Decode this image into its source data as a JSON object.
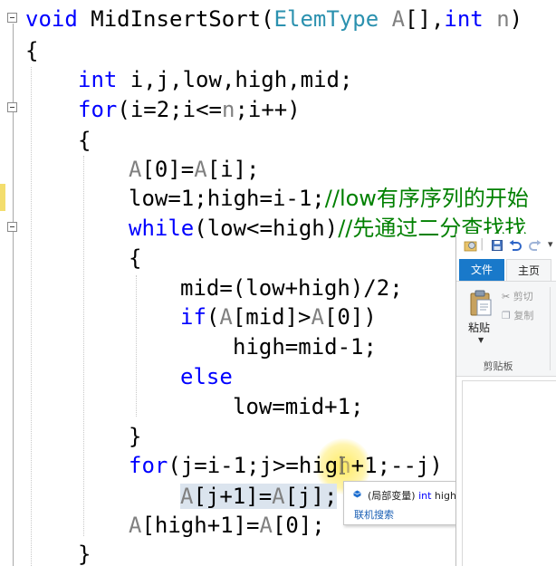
{
  "editor": {
    "function": {
      "keyword_void": "void",
      "name": " MidInsertSort(",
      "param_type": "ElemType",
      "param_a": " A",
      "param_mid": "[],",
      "keyword_int": "int",
      "param_n": " n",
      "close": ")"
    },
    "brace_open_outer": "{",
    "decl": {
      "keyword": "int",
      "rest": " i,j,low,high,mid;"
    },
    "for1": {
      "keyword": "for",
      "paren_open": "(",
      "i1": "i",
      "mid1": "=2;",
      "i2": "i",
      "mid2": "<=",
      "n": "n",
      "mid3": ";",
      "i3": "i",
      "end": "++)"
    },
    "brace_open_for1": "{",
    "assign_a0": {
      "a1": "A",
      "text1": "[0]=",
      "a2": "A",
      "text2": "[",
      "i": "i",
      "text3": "];"
    },
    "low_high_init": {
      "text1": "low=1;high=",
      "i": "i",
      "text2": "-1;",
      "comment": "//low有序序列的开始"
    },
    "while_line": {
      "keyword": "while",
      "text": "(low<=high)",
      "comment": "//先通过二分查找找"
    },
    "brace_open_while": "{",
    "mid_calc": "mid=(low+high)/2;",
    "if_line": {
      "keyword": "if",
      "paren": "(",
      "a1": "A",
      "text1": "[mid]>",
      "a2": "A",
      "text2": "[0])"
    },
    "high_assign": "high=mid-1;",
    "else_keyword": "else",
    "low_assign": "low=mid+1;",
    "brace_close_while": "}",
    "for2": {
      "keyword": "for",
      "text1": "(j=",
      "i": "i",
      "text2": "-1;j>=hig",
      "caret_char": "h",
      "text3": "+1;--j)"
    },
    "shift_line": {
      "a1": "A",
      "text1": "[j+1]=",
      "a2": "A",
      "text2": "[j];"
    },
    "final_assign": {
      "a1": "A",
      "text1": "[high+1]=",
      "a2": "A",
      "text2": "[0];"
    },
    "brace_close_for1": "}"
  },
  "explorer": {
    "tabs": {
      "file": "文件",
      "home": "主页"
    },
    "clipboard": {
      "paste": "粘贴",
      "cut": "剪切",
      "copy": "复制",
      "group": "剪贴板"
    }
  },
  "tooltip": {
    "kind": "(局部变量)",
    "type": "int",
    "name": " high",
    "link": "联机搜索"
  },
  "colors": {
    "keyword": "#0000ff",
    "type": "#2b91af",
    "param": "#808080",
    "comment": "#008000",
    "ribbon_file_tab": "#1979ca",
    "change_marker": "#f3dd6d",
    "cursor_highlight": "#ffe846"
  },
  "icons": [
    "fold-collapse-icon",
    "paste-icon",
    "cut-icon",
    "copy-icon",
    "save-icon",
    "undo-icon",
    "redo-icon",
    "folder-properties-icon",
    "variable-icon",
    "ibeam-cursor-icon"
  ]
}
